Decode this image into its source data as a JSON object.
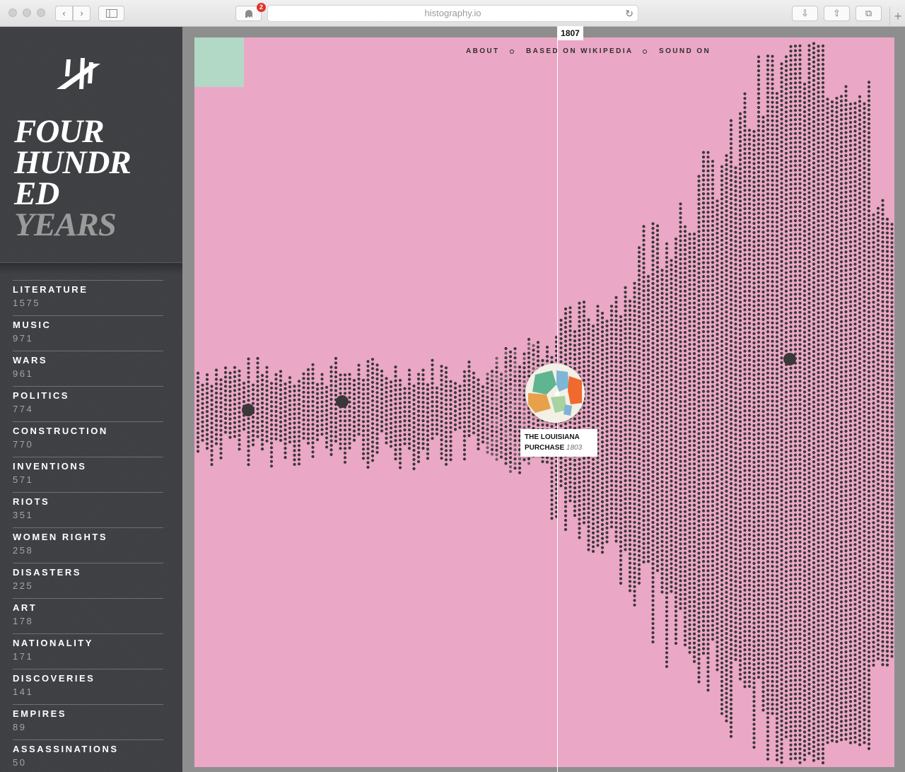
{
  "browser": {
    "url": "histography.io",
    "badge_count": "2"
  },
  "sidebar": {
    "title_lines": [
      "FOUR",
      "HUNDR",
      "ED"
    ],
    "title_accent": "YEARS",
    "categories": [
      {
        "name": "LITERATURE",
        "count": "1575"
      },
      {
        "name": "MUSIC",
        "count": "971"
      },
      {
        "name": "WARS",
        "count": "961"
      },
      {
        "name": "POLITICS",
        "count": "774"
      },
      {
        "name": "CONSTRUCTION",
        "count": "770"
      },
      {
        "name": "INVENTIONS",
        "count": "571"
      },
      {
        "name": "RIOTS",
        "count": "351"
      },
      {
        "name": "WOMEN RIGHTS",
        "count": "258"
      },
      {
        "name": "DISASTERS",
        "count": "225"
      },
      {
        "name": "ART",
        "count": "178"
      },
      {
        "name": "NATIONALITY",
        "count": "171"
      },
      {
        "name": "DISCOVERIES",
        "count": "141"
      },
      {
        "name": "EMPIRES",
        "count": "89"
      },
      {
        "name": "ASSASSINATIONS",
        "count": "50"
      }
    ]
  },
  "nav": {
    "about": "ABOUT",
    "based_on": "BASED ON WIKIPEDIA",
    "sound": "SOUND ON"
  },
  "timeline": {
    "current_year": "1807",
    "highlight": {
      "title_line1": "THE LOUISIANA",
      "title_line2": "PURCHASE",
      "year": "1803"
    }
  },
  "colors": {
    "background_pink": "#eba8c6",
    "dot": "#3b3839",
    "sidebar": "#3d3f42",
    "corner_tile": "#b2d8c6"
  }
}
